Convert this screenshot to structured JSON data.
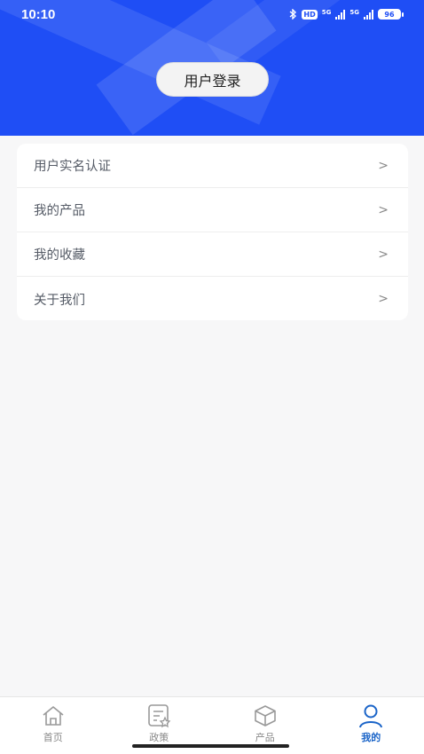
{
  "status_bar": {
    "time": "10:10",
    "hd": "HD",
    "net1": "5G",
    "net2": "5G",
    "battery": "96"
  },
  "header": {
    "login_label": "用户登录",
    "accent_color": "#1f4ef5"
  },
  "menu": {
    "items": [
      {
        "label": "用户实名认证",
        "icon": "chevron-right"
      },
      {
        "label": "我的产品",
        "icon": "chevron-right"
      },
      {
        "label": "我的收藏",
        "icon": "chevron-right"
      },
      {
        "label": "关于我们",
        "icon": "chevron-right"
      }
    ]
  },
  "bottom_nav": {
    "items": [
      {
        "label": "首页",
        "icon": "home-icon"
      },
      {
        "label": "政策",
        "icon": "policy-icon"
      },
      {
        "label": "产品",
        "icon": "box-icon"
      },
      {
        "label": "我的",
        "icon": "user-icon",
        "active": true
      }
    ],
    "active_color": "#1a64c8"
  }
}
